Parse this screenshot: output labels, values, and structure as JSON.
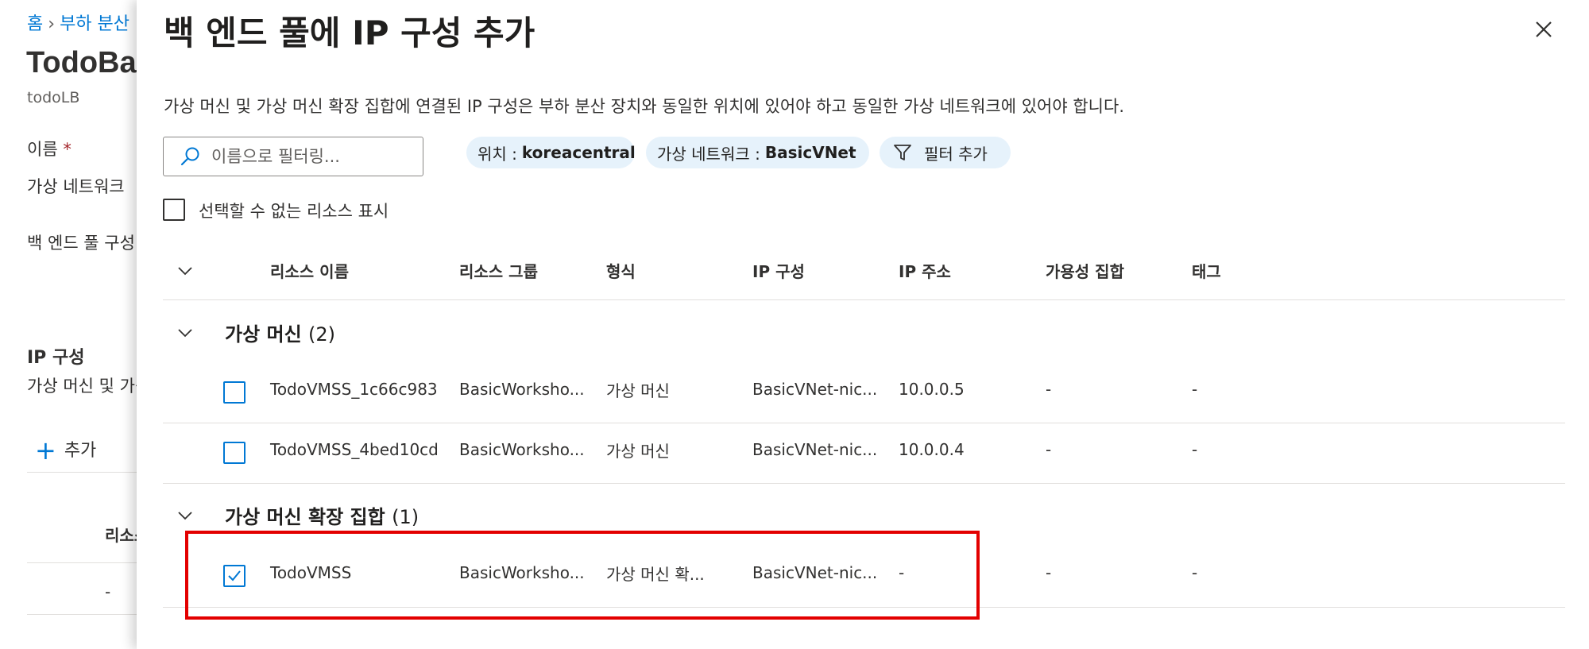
{
  "background": {
    "breadcrumb": [
      "홈",
      "부하 분산"
    ],
    "title": "TodoBackend",
    "subtitle": "todoLB",
    "name_label": "이름",
    "required_mark": "*",
    "vnet_label": "가상 네트워크",
    "pool_config_label": "백 엔드 풀 구성",
    "ip_section_title": "IP 구성",
    "ip_section_desc": "가상 머신 및 가상",
    "add_label": "추가",
    "col_header": "리소스",
    "row_dash": "-"
  },
  "panel": {
    "title": "백 엔드 풀에 IP 구성 추가",
    "description": "가상 머신 및 가상 머신 확장 집합에 연결된 IP 구성은 부하 분산 장치와 동일한 위치에 있어야 하고 동일한 가상 네트워크에 있어야 합니다.",
    "filter_placeholder": "이름으로 필터링...",
    "pills": [
      {
        "key": "위치 :",
        "value": "koreacentral"
      },
      {
        "key": "가상 네트워크 :",
        "value": "BasicVNet"
      }
    ],
    "add_filter": "필터 추가",
    "show_unselectable": "선택할 수 없는 리소스 표시",
    "columns": [
      "리소스 이름",
      "리소스 그룹",
      "형식",
      "IP 구성",
      "IP 주소",
      "가용성 집합",
      "태그"
    ],
    "groups": [
      {
        "name": "가상 머신",
        "count": "(2)",
        "rows": [
          {
            "checked": false,
            "cells": [
              "TodoVMSS_1c66c983",
              "BasicWorksho...",
              "가상 머신",
              "BasicVNet-nic...",
              "10.0.0.5",
              "-",
              "-"
            ]
          },
          {
            "checked": false,
            "cells": [
              "TodoVMSS_4bed10cd",
              "BasicWorksho...",
              "가상 머신",
              "BasicVNet-nic...",
              "10.0.0.4",
              "-",
              "-"
            ]
          }
        ]
      },
      {
        "name": "가상 머신 확장 집합",
        "count": "(1)",
        "rows": [
          {
            "checked": true,
            "cells": [
              "TodoVMSS",
              "BasicWorksho...",
              "가상 머신 확...",
              "BasicVNet-nic...",
              "-",
              "-",
              "-"
            ]
          }
        ]
      }
    ]
  },
  "colors": {
    "accent": "#0078d4",
    "highlight": "#e30000",
    "pill_bg": "#e6f2fb"
  }
}
